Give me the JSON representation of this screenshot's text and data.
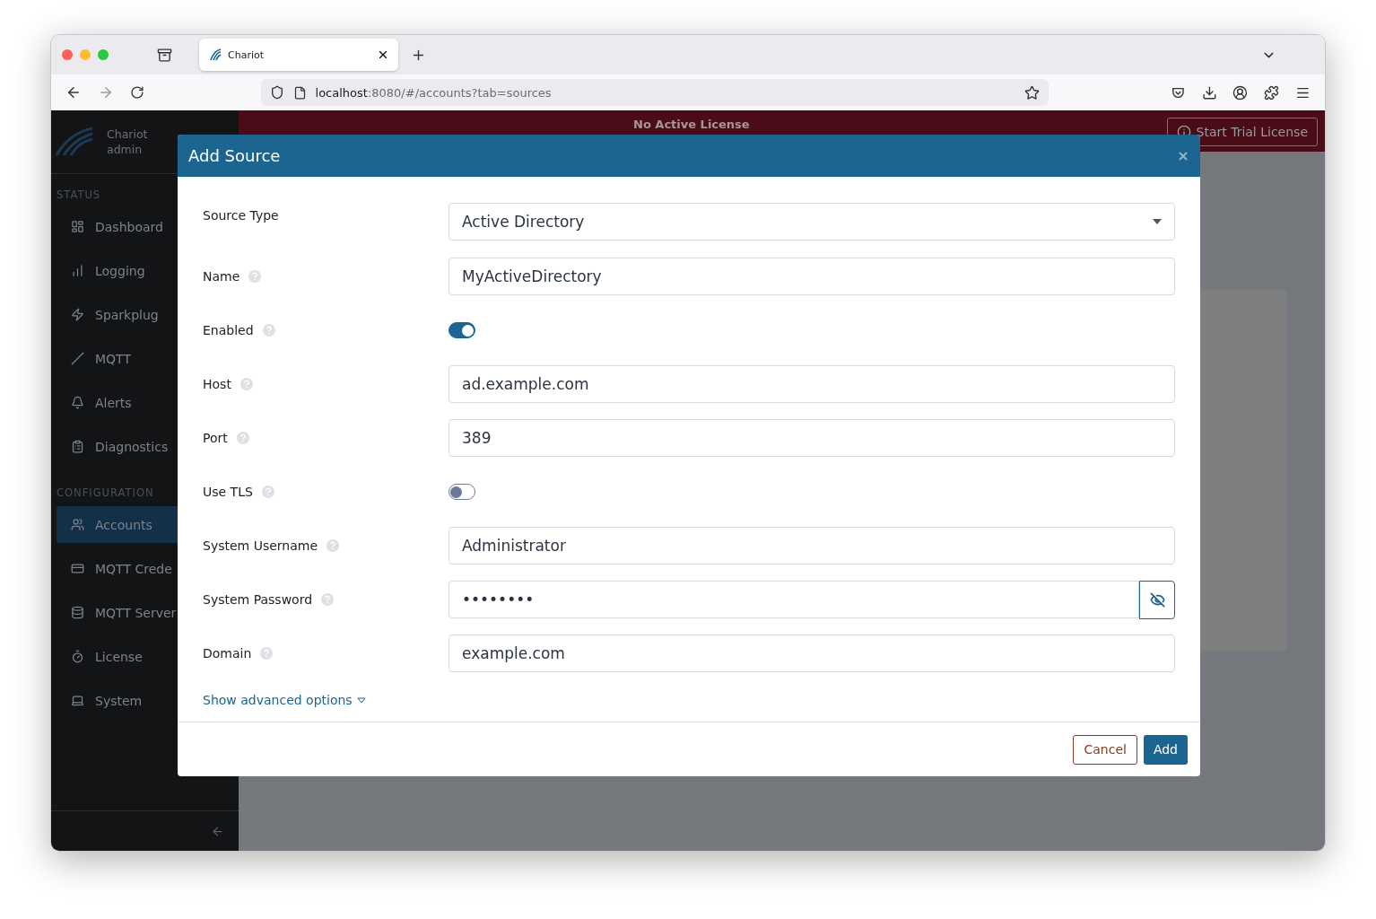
{
  "browser": {
    "tab": {
      "title": "Chariot"
    },
    "url": {
      "host": "localhost",
      "rest": ":8080/#/accounts?tab=sources"
    }
  },
  "sidebar": {
    "brand": "Chariot",
    "user": "admin",
    "sections": [
      {
        "heading": "STATUS",
        "items": [
          {
            "label": "Dashboard",
            "selected": false
          },
          {
            "label": "Logging",
            "selected": false
          },
          {
            "label": "Sparkplug",
            "selected": false
          },
          {
            "label": "MQTT",
            "selected": false
          },
          {
            "label": "Alerts",
            "selected": false
          },
          {
            "label": "Diagnostics",
            "selected": false
          }
        ]
      },
      {
        "heading": "CONFIGURATION",
        "items": [
          {
            "label": "Accounts",
            "selected": true
          },
          {
            "label": "MQTT Crede",
            "selected": false
          },
          {
            "label": "MQTT Server",
            "selected": false
          },
          {
            "label": "License",
            "selected": false
          },
          {
            "label": "System",
            "selected": false
          }
        ]
      }
    ]
  },
  "banner": {
    "message": "No Active License",
    "button": "Start Trial License"
  },
  "modal": {
    "title": "Add Source",
    "fields": [
      {
        "kind": "select",
        "label": "Source Type",
        "help": false,
        "value": "Active Directory"
      },
      {
        "kind": "text",
        "label": "Name",
        "help": true,
        "value": "MyActiveDirectory"
      },
      {
        "kind": "toggle",
        "label": "Enabled",
        "help": true,
        "on": true
      },
      {
        "kind": "text",
        "label": "Host",
        "help": true,
        "value": "ad.example.com"
      },
      {
        "kind": "text",
        "label": "Port",
        "help": true,
        "value": "389"
      },
      {
        "kind": "toggle",
        "label": "Use TLS",
        "help": true,
        "on": false
      },
      {
        "kind": "text",
        "label": "System Username",
        "help": true,
        "value": "Administrator"
      },
      {
        "kind": "password",
        "label": "System Password",
        "help": true,
        "value": "••••••••"
      },
      {
        "kind": "text",
        "label": "Domain",
        "help": true,
        "value": "example.com"
      }
    ],
    "advanced_link": "Show advanced options",
    "cancel": "Cancel",
    "add": "Add"
  }
}
